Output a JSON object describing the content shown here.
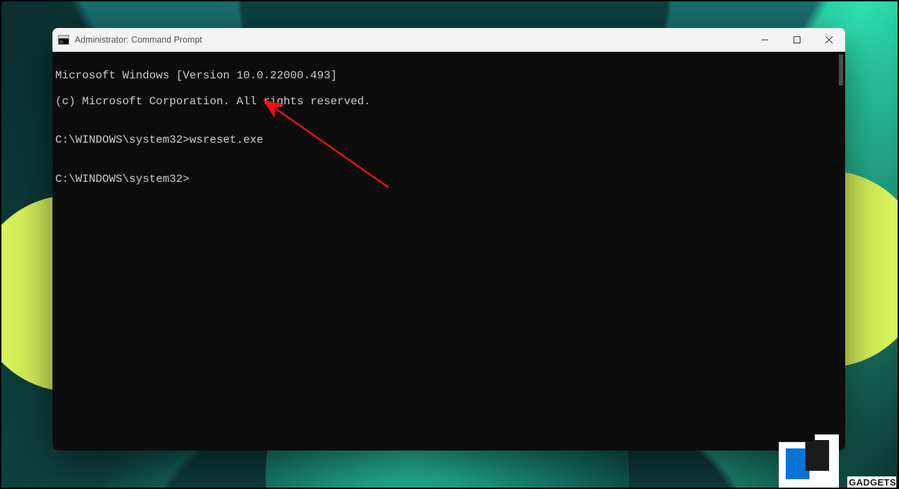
{
  "window": {
    "title": "Administrator: Command Prompt"
  },
  "console": {
    "line1": "Microsoft Windows [Version 10.0.22000.493]",
    "line2": "(c) Microsoft Corporation. All rights reserved.",
    "blank1": "",
    "prompt1_path": "C:\\WINDOWS\\system32>",
    "prompt1_cmd": "wsreset.exe",
    "blank2": "",
    "prompt2_path": "C:\\WINDOWS\\system32>",
    "prompt2_cmd": ""
  },
  "annotation": {
    "arrow_color": "#e11",
    "target_description": "wsreset.exe command"
  },
  "watermark": {
    "text": "GADGETS"
  }
}
